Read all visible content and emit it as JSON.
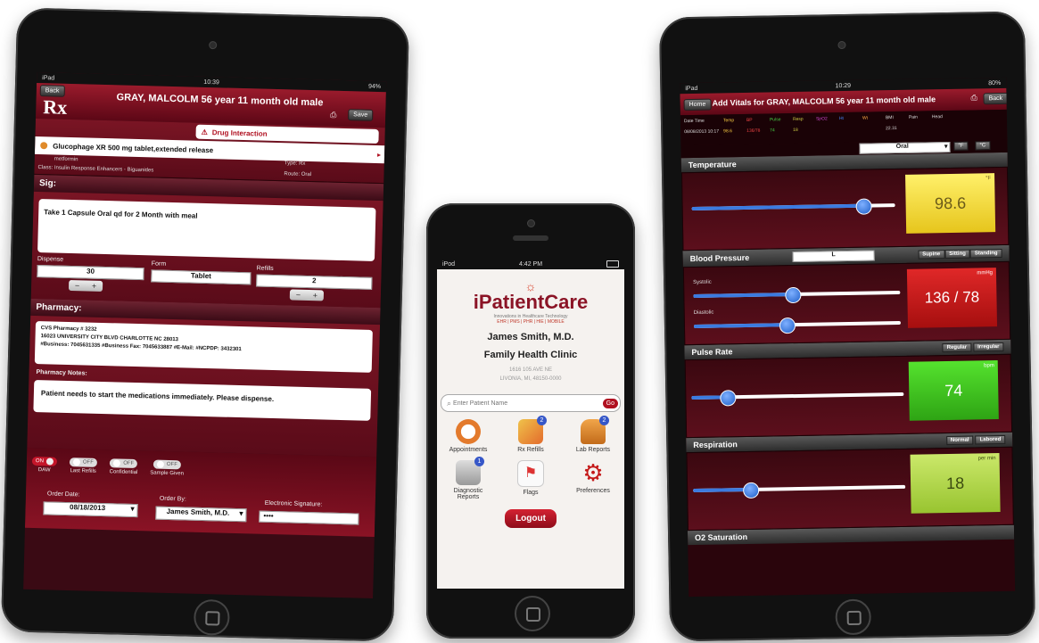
{
  "left_ipad": {
    "status": {
      "carrier": "iPad",
      "time": "10:39",
      "battery": "94%"
    },
    "back_button": "Back",
    "patient_header": "GRAY, MALCOLM 56 year 11 month old male",
    "rx_logo": "Rx",
    "save_button": "Save",
    "drug_interaction": "Drug Interaction",
    "drug_name": "Glucophage XR 500 mg tablet,extended release",
    "drug_generic": "metformin",
    "drug_class": "Class: Insulin Response Enhancers - Biguanides",
    "type_label": "Type: Rx",
    "route_label": "Route: Oral",
    "sig_title": "Sig:",
    "sig_text": "Take 1 Capsule Oral qd for 2 Month with meal",
    "dispense_label": "Dispense",
    "dispense_value": "30",
    "form_label": "Form",
    "form_value": "Tablet",
    "refills_label": "Refills",
    "refills_value": "2",
    "stepper_minus": "−",
    "stepper_plus": "+",
    "pharmacy_title": "Pharmacy:",
    "pharmacy_name": "CVS Pharmacy # 3232",
    "pharmacy_addr": "16023 UNIVERSITY CITY BLVD CHARLOTTE NC 28013",
    "pharmacy_contact": "#Business: 7045631335  #Business Fax: 7045633887  #E-Mail:  #NCPDP: 3432301",
    "notes_label": "Pharmacy Notes:",
    "notes_text": "Patient needs to start the medications immediately. Please dispense.",
    "toggles": [
      {
        "state": "ON",
        "label": "DAW"
      },
      {
        "state": "OFF",
        "label": "Last Refills"
      },
      {
        "state": "OFF",
        "label": "Confidential"
      },
      {
        "state": "OFF",
        "label": "Sample Given"
      }
    ],
    "order_date_label": "Order Date:",
    "order_date_value": "08/18/2013",
    "order_by_label": "Order By:",
    "order_by_value": "James Smith, M.D.",
    "esig_label": "Electronic Signature:",
    "esig_value": "••••"
  },
  "iphone": {
    "status": {
      "carrier": "iPod",
      "time": "4:42 PM"
    },
    "brand": "iPatientCare",
    "tagline": "Innovations in Healthcare Technology",
    "sub_tagline": "EHR | PMS | PHR | HIE | MOBILE",
    "doctor": "James Smith, M.D.",
    "clinic": "Family Health Clinic",
    "address1": "1616 105 AVE NE",
    "address2": "LIVONIA, MI, 48150-0000",
    "search_placeholder": "Enter Patient Name",
    "go_button": "Go",
    "icons": [
      {
        "label": "Appointments",
        "badge": ""
      },
      {
        "label": "Rx Refills",
        "badge": "2"
      },
      {
        "label": "Lab Reports",
        "badge": "2"
      },
      {
        "label": "Diagnostic Reports",
        "badge": "1"
      },
      {
        "label": "Flags",
        "badge": ""
      },
      {
        "label": "Preferences",
        "badge": ""
      }
    ],
    "logout_button": "Logout"
  },
  "right_ipad": {
    "status": {
      "carrier": "iPad",
      "time": "10:29",
      "battery": "80%"
    },
    "home_button": "Home",
    "title": "Add Vitals for GRAY, MALCOLM 56 year 11 month old male",
    "back_button": "Back",
    "table_headers": [
      "Date Time",
      "Temp",
      "BP",
      "Pulse",
      "Resp",
      "SpO2",
      "Ht",
      "Wt",
      "BMI",
      "Pain",
      "Head"
    ],
    "table_row": [
      "08/08/2013 10:17",
      "98.6",
      "136/78",
      "74",
      "18",
      "",
      "",
      "",
      "22.31",
      "",
      ""
    ],
    "route_select": "Oral",
    "temp_unit_f": "°F",
    "temp_unit_c": "°C",
    "temperature": {
      "title": "Temperature",
      "value": "98.6",
      "unit": "°F",
      "level": 0.84
    },
    "bp": {
      "title": "Blood Pressure",
      "side_select": "L",
      "positions": [
        "Supine",
        "Sitting",
        "Standing"
      ],
      "systolic_label": "Systolic",
      "diastolic_label": "Diastolic",
      "value": "136 / 78",
      "status": "mmHg",
      "systolic_level": 0.48,
      "diastolic_level": 0.45
    },
    "pulse": {
      "title": "Pulse Rate",
      "modes": [
        "Regular",
        "Irregular"
      ],
      "value": "74",
      "unit": "bpm",
      "level": 0.17
    },
    "resp": {
      "title": "Respiration",
      "modes": [
        "Normal",
        "Labored"
      ],
      "value": "18",
      "unit": "per min",
      "level": 0.27
    },
    "o2_title": "O2 Saturation"
  },
  "colors": {
    "maroon": "#5c0716",
    "temp_box": "#f3e24a",
    "bp_box": "#c41818",
    "pulse_box": "#3cc21a",
    "resp_box": "#b6d84a"
  }
}
